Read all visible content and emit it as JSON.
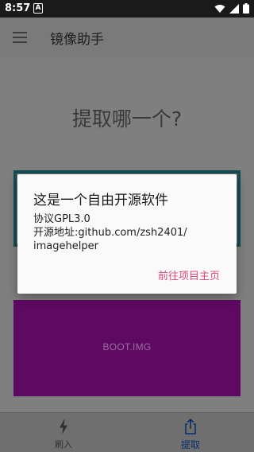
{
  "status_bar": {
    "time": "8:57",
    "notification_badge": "A"
  },
  "app_bar": {
    "title": "镜像助手"
  },
  "main": {
    "question": "提取哪一个?",
    "cards": [
      {
        "label": "",
        "color": "#134e55"
      },
      {
        "label": "BOOT.IMG",
        "color": "#5e0962"
      }
    ]
  },
  "dialog": {
    "title": "这是一个自由开源软件",
    "body_lines": [
      "协议GPL3.0",
      "开源地址:github.com/zsh2401/",
      "imagehelper"
    ],
    "action_label": "前往项目主页",
    "action_color": "#d64a79"
  },
  "bottom_nav": {
    "items": [
      {
        "label": "刷入",
        "icon": "flash-icon"
      },
      {
        "label": "提取",
        "icon": "share-upload-icon"
      }
    ],
    "active_color": "#0a2d6b"
  }
}
